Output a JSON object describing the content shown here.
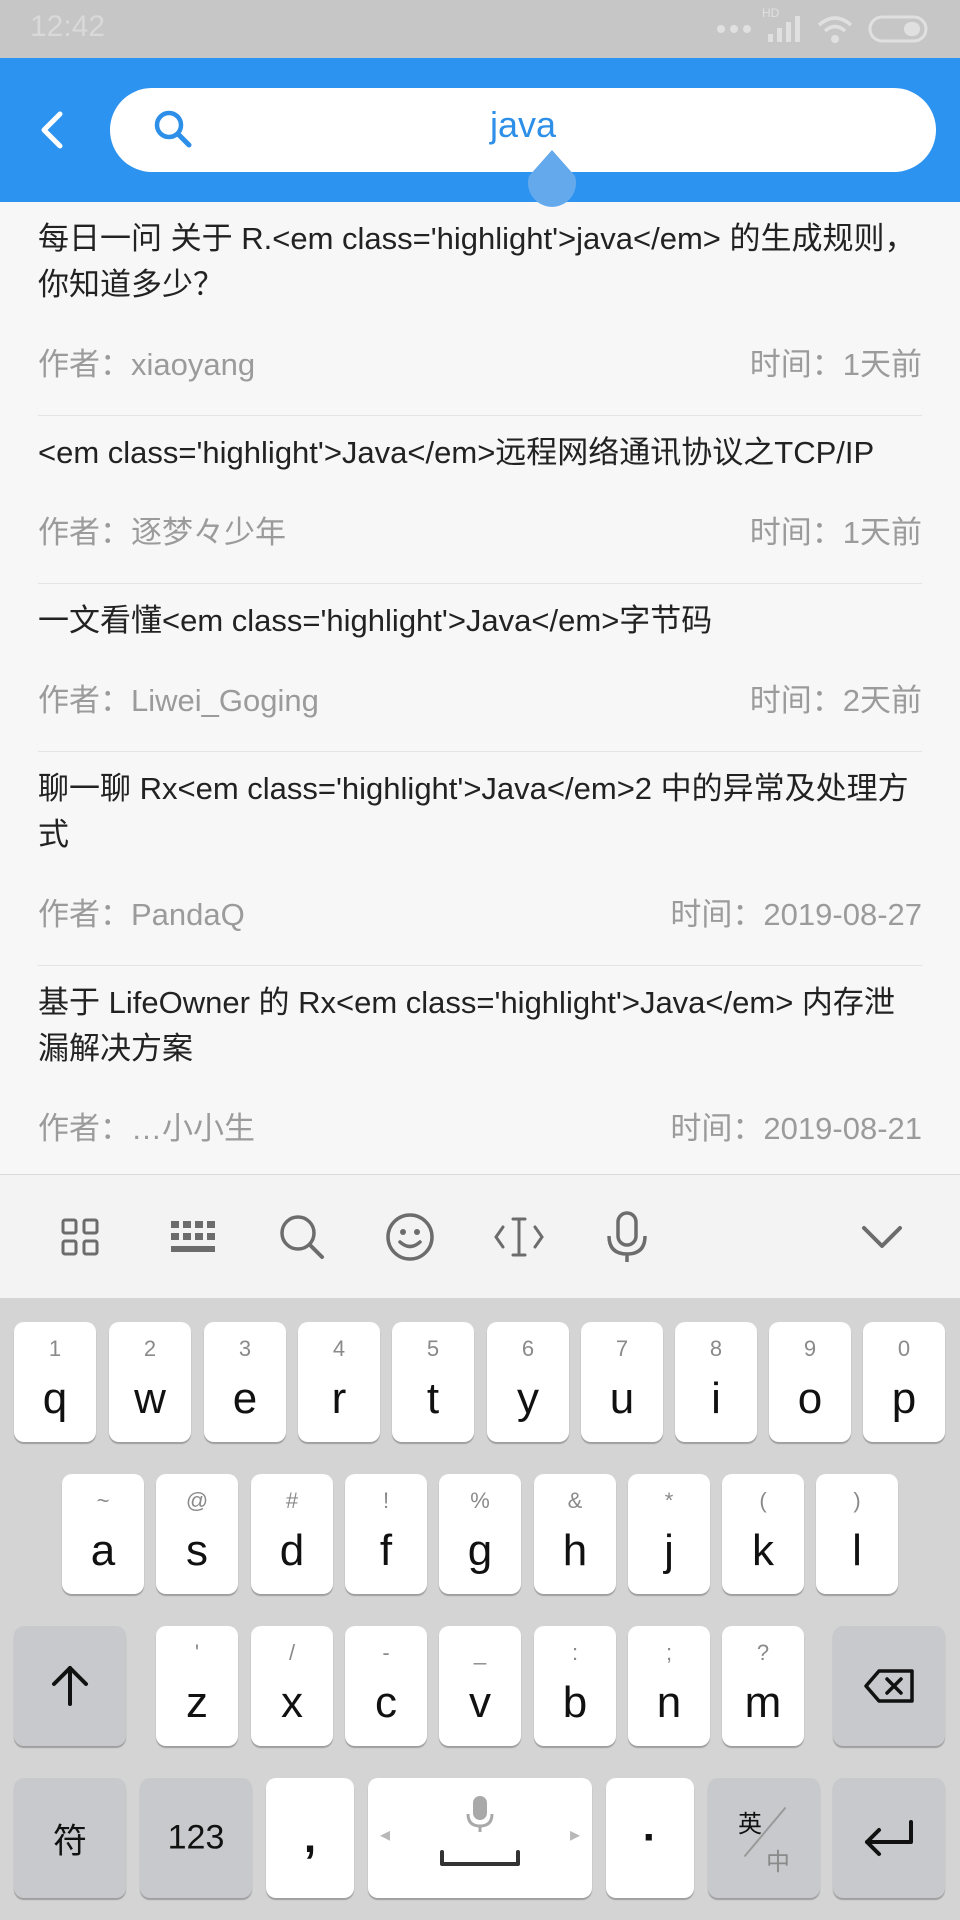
{
  "status_bar": {
    "time": "12:42",
    "network_label": "HD"
  },
  "search": {
    "query": "java"
  },
  "results": [
    {
      "title": "每日一问 关于 R.<em class='highlight'>java</em> 的生成规则，你知道多少？",
      "author": "作者：xiaoyang",
      "time": "时间：1天前"
    },
    {
      "title": "<em class='highlight'>Java</em>远程网络通讯协议之TCP/IP",
      "author": "作者：逐梦々少年",
      "time": "时间：1天前"
    },
    {
      "title": "一文看懂<em class='highlight'>Java</em>字节码",
      "author": "作者：Liwei_Goging",
      "time": "时间：2天前"
    },
    {
      "title": "聊一聊 Rx<em class='highlight'>Java</em>2 中的异常及处理方式",
      "author": "作者：PandaQ",
      "time": "时间：2019-08-27"
    },
    {
      "title": "基于 LifeOwner 的 Rx<em class='highlight'>Java</em> 内存泄漏解决方案",
      "author": "作者：…小小生",
      "time": "时间：2019-08-21"
    }
  ],
  "toolbar": {
    "icons": [
      "apps-icon",
      "keyboard-icon",
      "search-icon",
      "emoji-icon",
      "cursor-move-icon",
      "microphone-icon",
      "collapse-icon"
    ]
  },
  "keyboard": {
    "row1": [
      {
        "main": "q",
        "sub": "1"
      },
      {
        "main": "w",
        "sub": "2"
      },
      {
        "main": "e",
        "sub": "3"
      },
      {
        "main": "r",
        "sub": "4"
      },
      {
        "main": "t",
        "sub": "5"
      },
      {
        "main": "y",
        "sub": "6"
      },
      {
        "main": "u",
        "sub": "7"
      },
      {
        "main": "i",
        "sub": "8"
      },
      {
        "main": "o",
        "sub": "9"
      },
      {
        "main": "p",
        "sub": "0"
      }
    ],
    "row2": [
      {
        "main": "a",
        "sub": "~"
      },
      {
        "main": "s",
        "sub": "@"
      },
      {
        "main": "d",
        "sub": "#"
      },
      {
        "main": "f",
        "sub": "!"
      },
      {
        "main": "g",
        "sub": "%"
      },
      {
        "main": "h",
        "sub": "&"
      },
      {
        "main": "j",
        "sub": "*"
      },
      {
        "main": "k",
        "sub": "("
      },
      {
        "main": "l",
        "sub": ")"
      }
    ],
    "row3": [
      {
        "main": "z",
        "sub": "'"
      },
      {
        "main": "x",
        "sub": "/"
      },
      {
        "main": "c",
        "sub": "-"
      },
      {
        "main": "v",
        "sub": "_"
      },
      {
        "main": "b",
        "sub": ":"
      },
      {
        "main": "n",
        "sub": ";"
      },
      {
        "main": "m",
        "sub": "?"
      }
    ],
    "symbols_label": "符",
    "numbers_label": "123",
    "comma_label": ",",
    "period_label": "·",
    "lang_top": "英",
    "lang_bottom": "中"
  },
  "colors": {
    "accent": "#2d93f0",
    "status_bar": "#c6c6c6",
    "keyboard_bg": "#d4d4d4"
  }
}
